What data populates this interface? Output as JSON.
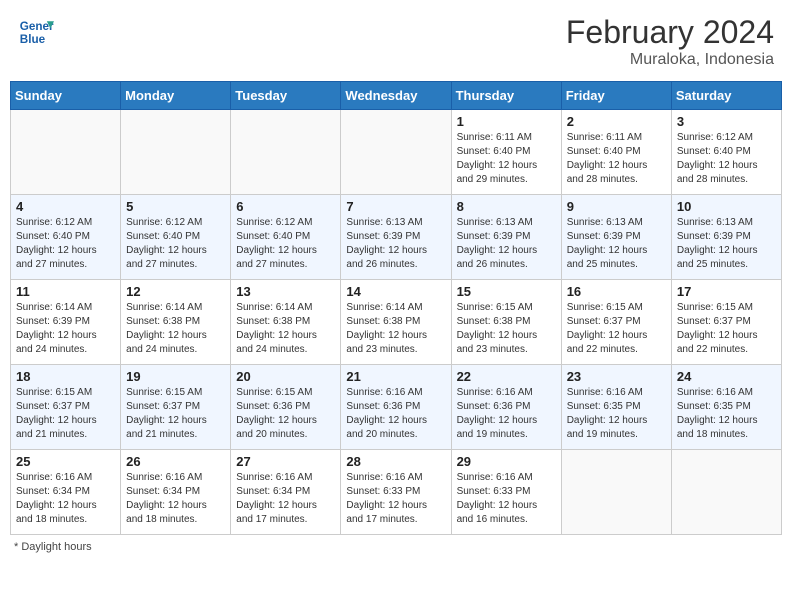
{
  "header": {
    "logo_line1": "General",
    "logo_line2": "Blue",
    "month_year": "February 2024",
    "location": "Muraloka, Indonesia"
  },
  "days_of_week": [
    "Sunday",
    "Monday",
    "Tuesday",
    "Wednesday",
    "Thursday",
    "Friday",
    "Saturday"
  ],
  "weeks": [
    [
      {
        "day": "",
        "info": ""
      },
      {
        "day": "",
        "info": ""
      },
      {
        "day": "",
        "info": ""
      },
      {
        "day": "",
        "info": ""
      },
      {
        "day": "1",
        "info": "Sunrise: 6:11 AM\nSunset: 6:40 PM\nDaylight: 12 hours and 29 minutes."
      },
      {
        "day": "2",
        "info": "Sunrise: 6:11 AM\nSunset: 6:40 PM\nDaylight: 12 hours and 28 minutes."
      },
      {
        "day": "3",
        "info": "Sunrise: 6:12 AM\nSunset: 6:40 PM\nDaylight: 12 hours and 28 minutes."
      }
    ],
    [
      {
        "day": "4",
        "info": "Sunrise: 6:12 AM\nSunset: 6:40 PM\nDaylight: 12 hours and 27 minutes."
      },
      {
        "day": "5",
        "info": "Sunrise: 6:12 AM\nSunset: 6:40 PM\nDaylight: 12 hours and 27 minutes."
      },
      {
        "day": "6",
        "info": "Sunrise: 6:12 AM\nSunset: 6:40 PM\nDaylight: 12 hours and 27 minutes."
      },
      {
        "day": "7",
        "info": "Sunrise: 6:13 AM\nSunset: 6:39 PM\nDaylight: 12 hours and 26 minutes."
      },
      {
        "day": "8",
        "info": "Sunrise: 6:13 AM\nSunset: 6:39 PM\nDaylight: 12 hours and 26 minutes."
      },
      {
        "day": "9",
        "info": "Sunrise: 6:13 AM\nSunset: 6:39 PM\nDaylight: 12 hours and 25 minutes."
      },
      {
        "day": "10",
        "info": "Sunrise: 6:13 AM\nSunset: 6:39 PM\nDaylight: 12 hours and 25 minutes."
      }
    ],
    [
      {
        "day": "11",
        "info": "Sunrise: 6:14 AM\nSunset: 6:39 PM\nDaylight: 12 hours and 24 minutes."
      },
      {
        "day": "12",
        "info": "Sunrise: 6:14 AM\nSunset: 6:38 PM\nDaylight: 12 hours and 24 minutes."
      },
      {
        "day": "13",
        "info": "Sunrise: 6:14 AM\nSunset: 6:38 PM\nDaylight: 12 hours and 24 minutes."
      },
      {
        "day": "14",
        "info": "Sunrise: 6:14 AM\nSunset: 6:38 PM\nDaylight: 12 hours and 23 minutes."
      },
      {
        "day": "15",
        "info": "Sunrise: 6:15 AM\nSunset: 6:38 PM\nDaylight: 12 hours and 23 minutes."
      },
      {
        "day": "16",
        "info": "Sunrise: 6:15 AM\nSunset: 6:37 PM\nDaylight: 12 hours and 22 minutes."
      },
      {
        "day": "17",
        "info": "Sunrise: 6:15 AM\nSunset: 6:37 PM\nDaylight: 12 hours and 22 minutes."
      }
    ],
    [
      {
        "day": "18",
        "info": "Sunrise: 6:15 AM\nSunset: 6:37 PM\nDaylight: 12 hours and 21 minutes."
      },
      {
        "day": "19",
        "info": "Sunrise: 6:15 AM\nSunset: 6:37 PM\nDaylight: 12 hours and 21 minutes."
      },
      {
        "day": "20",
        "info": "Sunrise: 6:15 AM\nSunset: 6:36 PM\nDaylight: 12 hours and 20 minutes."
      },
      {
        "day": "21",
        "info": "Sunrise: 6:16 AM\nSunset: 6:36 PM\nDaylight: 12 hours and 20 minutes."
      },
      {
        "day": "22",
        "info": "Sunrise: 6:16 AM\nSunset: 6:36 PM\nDaylight: 12 hours and 19 minutes."
      },
      {
        "day": "23",
        "info": "Sunrise: 6:16 AM\nSunset: 6:35 PM\nDaylight: 12 hours and 19 minutes."
      },
      {
        "day": "24",
        "info": "Sunrise: 6:16 AM\nSunset: 6:35 PM\nDaylight: 12 hours and 18 minutes."
      }
    ],
    [
      {
        "day": "25",
        "info": "Sunrise: 6:16 AM\nSunset: 6:34 PM\nDaylight: 12 hours and 18 minutes."
      },
      {
        "day": "26",
        "info": "Sunrise: 6:16 AM\nSunset: 6:34 PM\nDaylight: 12 hours and 18 minutes."
      },
      {
        "day": "27",
        "info": "Sunrise: 6:16 AM\nSunset: 6:34 PM\nDaylight: 12 hours and 17 minutes."
      },
      {
        "day": "28",
        "info": "Sunrise: 6:16 AM\nSunset: 6:33 PM\nDaylight: 12 hours and 17 minutes."
      },
      {
        "day": "29",
        "info": "Sunrise: 6:16 AM\nSunset: 6:33 PM\nDaylight: 12 hours and 16 minutes."
      },
      {
        "day": "",
        "info": ""
      },
      {
        "day": "",
        "info": ""
      }
    ]
  ],
  "footer": "* Daylight hours"
}
